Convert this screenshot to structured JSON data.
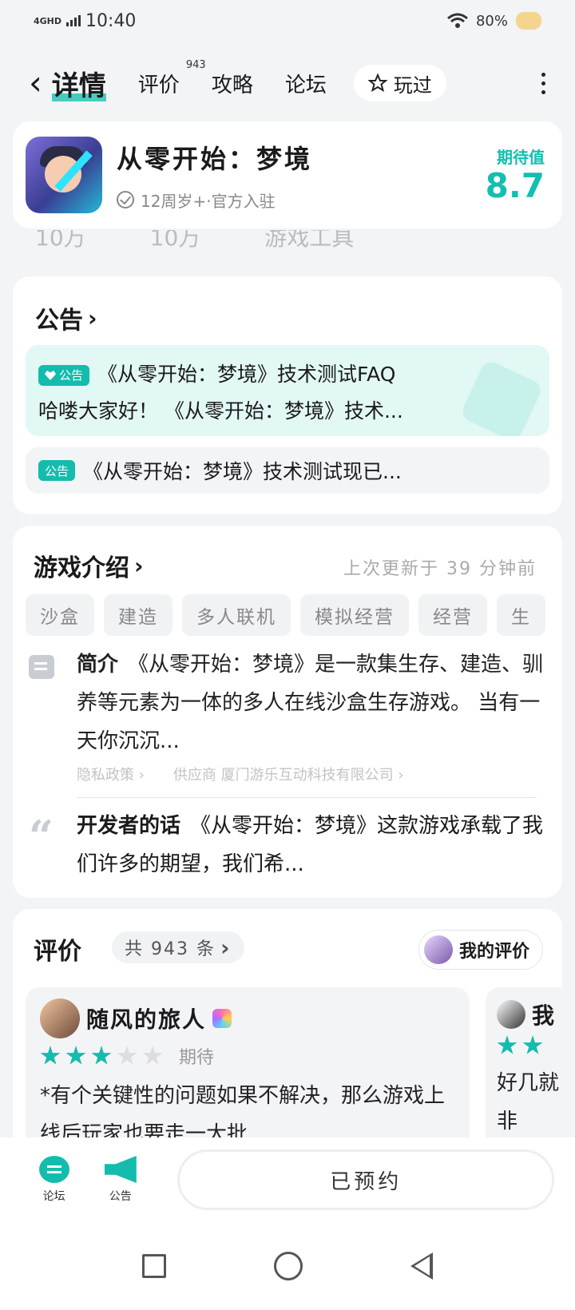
{
  "status": {
    "network": "4GHD",
    "time": "10:40",
    "battery": "80%"
  },
  "nav": {
    "title": "详情",
    "tabs": [
      {
        "label": "评价",
        "count": "943"
      },
      {
        "label": "攻略"
      },
      {
        "label": "论坛"
      }
    ],
    "played_label": "玩过"
  },
  "game": {
    "name": "从零开始：梦境",
    "meta": "12周岁+·官方入驻",
    "expect_label": "期待值",
    "expect_value": "8.7"
  },
  "peek_row": [
    "10万",
    "10万",
    "游戏工具"
  ],
  "notice": {
    "title": "公告",
    "tag": "公告",
    "main_line1": "《从零开始：梦境》技术测试FAQ",
    "main_line2": "哈喽大家好！ 《从零开始：梦境》技术...",
    "sub": "《从零开始：梦境》技术测试现已..."
  },
  "intro": {
    "title": "游戏介绍",
    "updated": "上次更新于 39 分钟前",
    "tags": [
      "沙盒",
      "建造",
      "多人联机",
      "模拟经营",
      "经营",
      "生"
    ],
    "desc_label": "简介",
    "desc": "《从零开始：梦境》是一款集生存、建造、驯养等元素为一体的多人在线沙盒生存游戏。 当有一天你沉沉...",
    "privacy": "隐私政策",
    "supplier": "供应商 厦门游乐互动科技有限公司",
    "dev_label": "开发者的话",
    "dev": "《从零开始：梦境》这款游戏承载了我们许多的期望，我们希..."
  },
  "reviews": {
    "title": "评价",
    "count_label": "共 943 条",
    "my_review": "我的评价",
    "items": [
      {
        "name": "随风的旅人",
        "rating": 3,
        "status": "期待",
        "text": "*有个关键性的问题如果不解决，那么游戏上线后玩家也要走一大批"
      },
      {
        "name": "我",
        "rating": 2,
        "text": "好几就非"
      }
    ]
  },
  "bottom": {
    "forum": "论坛",
    "notice": "公告",
    "booked": "已预约"
  },
  "colors": {
    "accent": "#14bcad",
    "background": "#f2f4f6"
  }
}
